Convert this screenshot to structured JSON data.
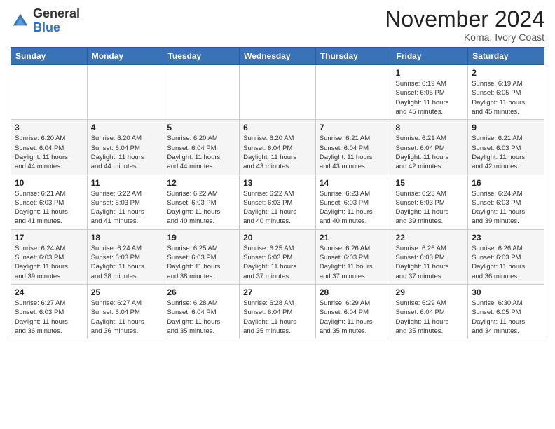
{
  "header": {
    "logo_general": "General",
    "logo_blue": "Blue",
    "month_title": "November 2024",
    "location": "Koma, Ivory Coast"
  },
  "weekdays": [
    "Sunday",
    "Monday",
    "Tuesday",
    "Wednesday",
    "Thursday",
    "Friday",
    "Saturday"
  ],
  "weeks": [
    [
      {
        "day": "",
        "info": ""
      },
      {
        "day": "",
        "info": ""
      },
      {
        "day": "",
        "info": ""
      },
      {
        "day": "",
        "info": ""
      },
      {
        "day": "",
        "info": ""
      },
      {
        "day": "1",
        "info": "Sunrise: 6:19 AM\nSunset: 6:05 PM\nDaylight: 11 hours\nand 45 minutes."
      },
      {
        "day": "2",
        "info": "Sunrise: 6:19 AM\nSunset: 6:05 PM\nDaylight: 11 hours\nand 45 minutes."
      }
    ],
    [
      {
        "day": "3",
        "info": "Sunrise: 6:20 AM\nSunset: 6:04 PM\nDaylight: 11 hours\nand 44 minutes."
      },
      {
        "day": "4",
        "info": "Sunrise: 6:20 AM\nSunset: 6:04 PM\nDaylight: 11 hours\nand 44 minutes."
      },
      {
        "day": "5",
        "info": "Sunrise: 6:20 AM\nSunset: 6:04 PM\nDaylight: 11 hours\nand 44 minutes."
      },
      {
        "day": "6",
        "info": "Sunrise: 6:20 AM\nSunset: 6:04 PM\nDaylight: 11 hours\nand 43 minutes."
      },
      {
        "day": "7",
        "info": "Sunrise: 6:21 AM\nSunset: 6:04 PM\nDaylight: 11 hours\nand 43 minutes."
      },
      {
        "day": "8",
        "info": "Sunrise: 6:21 AM\nSunset: 6:04 PM\nDaylight: 11 hours\nand 42 minutes."
      },
      {
        "day": "9",
        "info": "Sunrise: 6:21 AM\nSunset: 6:03 PM\nDaylight: 11 hours\nand 42 minutes."
      }
    ],
    [
      {
        "day": "10",
        "info": "Sunrise: 6:21 AM\nSunset: 6:03 PM\nDaylight: 11 hours\nand 41 minutes."
      },
      {
        "day": "11",
        "info": "Sunrise: 6:22 AM\nSunset: 6:03 PM\nDaylight: 11 hours\nand 41 minutes."
      },
      {
        "day": "12",
        "info": "Sunrise: 6:22 AM\nSunset: 6:03 PM\nDaylight: 11 hours\nand 40 minutes."
      },
      {
        "day": "13",
        "info": "Sunrise: 6:22 AM\nSunset: 6:03 PM\nDaylight: 11 hours\nand 40 minutes."
      },
      {
        "day": "14",
        "info": "Sunrise: 6:23 AM\nSunset: 6:03 PM\nDaylight: 11 hours\nand 40 minutes."
      },
      {
        "day": "15",
        "info": "Sunrise: 6:23 AM\nSunset: 6:03 PM\nDaylight: 11 hours\nand 39 minutes."
      },
      {
        "day": "16",
        "info": "Sunrise: 6:24 AM\nSunset: 6:03 PM\nDaylight: 11 hours\nand 39 minutes."
      }
    ],
    [
      {
        "day": "17",
        "info": "Sunrise: 6:24 AM\nSunset: 6:03 PM\nDaylight: 11 hours\nand 39 minutes."
      },
      {
        "day": "18",
        "info": "Sunrise: 6:24 AM\nSunset: 6:03 PM\nDaylight: 11 hours\nand 38 minutes."
      },
      {
        "day": "19",
        "info": "Sunrise: 6:25 AM\nSunset: 6:03 PM\nDaylight: 11 hours\nand 38 minutes."
      },
      {
        "day": "20",
        "info": "Sunrise: 6:25 AM\nSunset: 6:03 PM\nDaylight: 11 hours\nand 37 minutes."
      },
      {
        "day": "21",
        "info": "Sunrise: 6:26 AM\nSunset: 6:03 PM\nDaylight: 11 hours\nand 37 minutes."
      },
      {
        "day": "22",
        "info": "Sunrise: 6:26 AM\nSunset: 6:03 PM\nDaylight: 11 hours\nand 37 minutes."
      },
      {
        "day": "23",
        "info": "Sunrise: 6:26 AM\nSunset: 6:03 PM\nDaylight: 11 hours\nand 36 minutes."
      }
    ],
    [
      {
        "day": "24",
        "info": "Sunrise: 6:27 AM\nSunset: 6:03 PM\nDaylight: 11 hours\nand 36 minutes."
      },
      {
        "day": "25",
        "info": "Sunrise: 6:27 AM\nSunset: 6:04 PM\nDaylight: 11 hours\nand 36 minutes."
      },
      {
        "day": "26",
        "info": "Sunrise: 6:28 AM\nSunset: 6:04 PM\nDaylight: 11 hours\nand 35 minutes."
      },
      {
        "day": "27",
        "info": "Sunrise: 6:28 AM\nSunset: 6:04 PM\nDaylight: 11 hours\nand 35 minutes."
      },
      {
        "day": "28",
        "info": "Sunrise: 6:29 AM\nSunset: 6:04 PM\nDaylight: 11 hours\nand 35 minutes."
      },
      {
        "day": "29",
        "info": "Sunrise: 6:29 AM\nSunset: 6:04 PM\nDaylight: 11 hours\nand 35 minutes."
      },
      {
        "day": "30",
        "info": "Sunrise: 6:30 AM\nSunset: 6:05 PM\nDaylight: 11 hours\nand 34 minutes."
      }
    ]
  ]
}
